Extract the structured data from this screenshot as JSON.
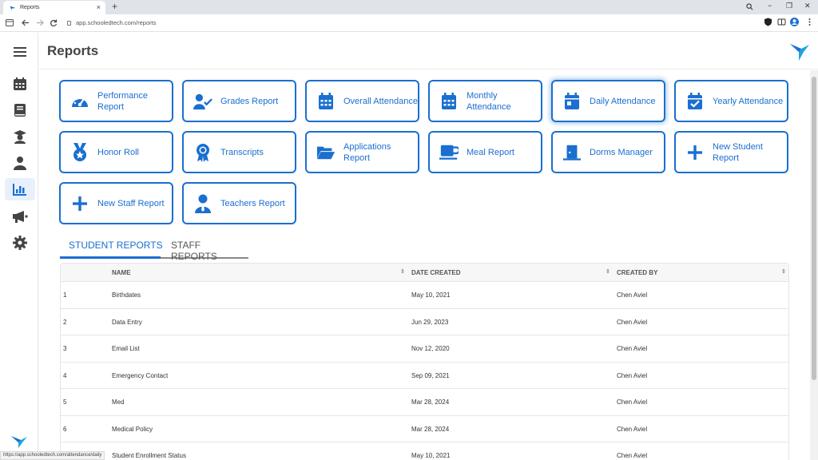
{
  "browser": {
    "tab_title": "Reports",
    "tab_close": "×",
    "new_tab": "+",
    "url": "app.schooledtech.com/reports",
    "status_url": "https://app.schooledtech.com/attendance/daily",
    "minimize": "−",
    "restore": "❐",
    "close": "✕"
  },
  "header": {
    "title": "Reports"
  },
  "sidebar": {
    "items": [
      {
        "icon": "menu-icon"
      },
      {
        "icon": "calendar-icon"
      },
      {
        "icon": "book-icon"
      },
      {
        "icon": "graduation-icon"
      },
      {
        "icon": "user-icon"
      },
      {
        "icon": "chart-icon",
        "active": true
      },
      {
        "icon": "megaphone-icon"
      },
      {
        "icon": "gear-icon"
      }
    ]
  },
  "report_cards": [
    {
      "label": "Performance Report",
      "icon": "gauge-icon"
    },
    {
      "label": "Grades Report",
      "icon": "user-check-icon"
    },
    {
      "label": "Overall Attendance",
      "icon": "calendar-grid-icon"
    },
    {
      "label": "Monthly Attendance",
      "icon": "calendar-grid-icon"
    },
    {
      "label": "Daily Attendance",
      "icon": "calendar-day-icon"
    },
    {
      "label": "Yearly Attendance",
      "icon": "calendar-check-icon"
    },
    {
      "label": "Honor Roll",
      "icon": "medal-icon"
    },
    {
      "label": "Transcripts",
      "icon": "award-icon"
    },
    {
      "label": "Applications Report",
      "icon": "folder-open-icon"
    },
    {
      "label": "Meal Report",
      "icon": "mug-icon"
    },
    {
      "label": "Dorms Manager",
      "icon": "door-icon"
    },
    {
      "label": "New Student Report",
      "icon": "plus-icon"
    },
    {
      "label": "New Staff Report",
      "icon": "plus-icon"
    },
    {
      "label": "Teachers Report",
      "icon": "teacher-icon"
    }
  ],
  "report_tabs": [
    {
      "label": "STUDENT REPORTS",
      "active": true
    },
    {
      "label": "STAFF REPORTS",
      "active": false
    }
  ],
  "table": {
    "columns": [
      "NAME",
      "DATE CREATED",
      "CREATED BY"
    ],
    "rows": [
      {
        "num": "1",
        "name": "Birthdates",
        "date": "May 10, 2021",
        "by": "Chen Aviel"
      },
      {
        "num": "2",
        "name": "Data Entry",
        "date": "Jun 29, 2023",
        "by": "Chen Aviel"
      },
      {
        "num": "3",
        "name": "Email List",
        "date": "Nov 12, 2020",
        "by": "Chen Aviel"
      },
      {
        "num": "4",
        "name": "Emergency Contact",
        "date": "Sep 09, 2021",
        "by": "Chen Aviel"
      },
      {
        "num": "5",
        "name": "Med",
        "date": "Mar 28, 2024",
        "by": "Chen Aviel"
      },
      {
        "num": "6",
        "name": "Medical Policy",
        "date": "Mar 28, 2024",
        "by": "Chen Aviel"
      },
      {
        "num": "",
        "name": "Student Enrollment Status",
        "date": "May 10, 2021",
        "by": "Chen Aviel"
      }
    ]
  },
  "colors": {
    "accent": "#1a6fd0",
    "brand_bird": "#1fa3e0"
  }
}
